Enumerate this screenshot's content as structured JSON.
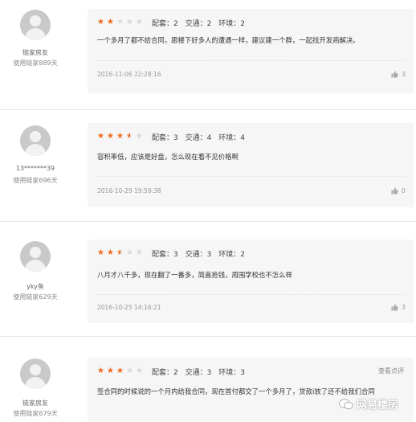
{
  "colors": {
    "star_filled": "#f26b1d",
    "star_empty": "#d8d8d8",
    "card_bg": "#f6f6f6"
  },
  "reviews": [
    {
      "username": "链家房友",
      "days": "使用链家889天",
      "rating": 2,
      "scores": {
        "peitao": "配套：2",
        "jiaotong": "交通：2",
        "huanjing": "环境：2"
      },
      "text": "一个多月了都不给合同，跟楼下好多人的遭遇一样，建议建一个群，一起找开发商解决。",
      "date": "2016-11-06 22:28:16",
      "likes": "3"
    },
    {
      "username": "13*******39",
      "days": "使用链家696天",
      "rating": 3.5,
      "scores": {
        "peitao": "配套：3",
        "jiaotong": "交通：4",
        "huanjing": "环境：4"
      },
      "text": "容积率低，应该是好盘，怎么现在看不见价格啊",
      "date": "2016-10-29 19:59:38",
      "likes": "0"
    },
    {
      "username": "yky鱼",
      "days": "使用链家629天",
      "rating": 2.5,
      "scores": {
        "peitao": "配套：3",
        "jiaotong": "交通：3",
        "huanjing": "环境：2"
      },
      "text": "八月才八千多，现在翻了一番多，简直抢钱，周围学校也不怎么样",
      "date": "2016-10-25 14:16:21",
      "likes": "3"
    },
    {
      "username": "链家房友",
      "days": "使用链家679天",
      "rating": 3,
      "scores": {
        "peitao": "配套：2",
        "jiaotong": "交通：3",
        "huanjing": "环境：3"
      },
      "text": "签合同的时候说的一个月内给我合同，现在首付都交了一个多月了，贷款i放了还不给我们合同",
      "more": "查看点评"
    }
  ],
  "watermark": "网易楼房"
}
